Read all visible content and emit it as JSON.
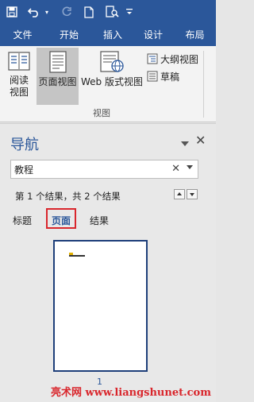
{
  "quick_access": {
    "icons": [
      "save-icon",
      "undo-icon",
      "redo-icon",
      "new-document-icon",
      "print-preview-icon",
      "customize-icon"
    ]
  },
  "tabs": [
    "文件",
    "开始",
    "插入",
    "设计",
    "布局"
  ],
  "ribbon": {
    "buttons": {
      "read_mode": [
        "阅读",
        "视图"
      ],
      "print_layout": "页面视图",
      "web_layout": "Web 版式视图"
    },
    "small_buttons": {
      "outline": "大纲视图",
      "draft": "草稿"
    },
    "group_label": "视图"
  },
  "nav_pane": {
    "title": "导航",
    "search_value": "教程",
    "result_text": "第 1 个结果，共 2 个结果",
    "tabs": [
      "标题",
      "页面",
      "结果"
    ],
    "active_tab": "页面",
    "page_number": "1"
  },
  "watermark": "亮术网 www.liangshunet.com",
  "colors": {
    "brand_blue": "#2b579a",
    "highlight_red": "#d9262c"
  }
}
